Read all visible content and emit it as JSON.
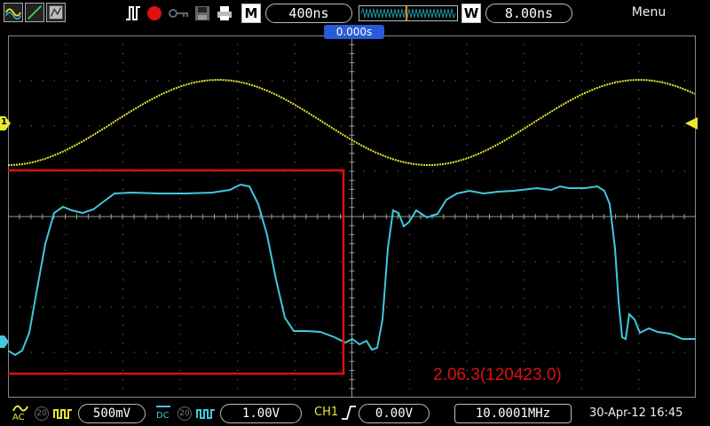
{
  "top": {
    "timebase": "400ns",
    "window_label": "W",
    "window_value": "8.00ns",
    "menu": "Menu",
    "mode_label": "M"
  },
  "screen": {
    "trigger_time": "0.000s",
    "version_text": "2.06.3(120423.0)",
    "ch1_marker": "1"
  },
  "bottom": {
    "ch1_coupling": "AC",
    "ch1_scale": "500mV",
    "ch2_coupling": "DC",
    "ch2_scale": "1.00V",
    "bw_limit": "20",
    "trig_source": "CH1",
    "trig_level": "0.00V",
    "frequency": "10.0001MHz",
    "datetime": "30-Apr-12 16:45"
  },
  "colors": {
    "ch1": "#e8e832",
    "ch2": "#40c8dc",
    "highlight": "#e01010",
    "trigger_badge": "#2a5bd7"
  }
}
